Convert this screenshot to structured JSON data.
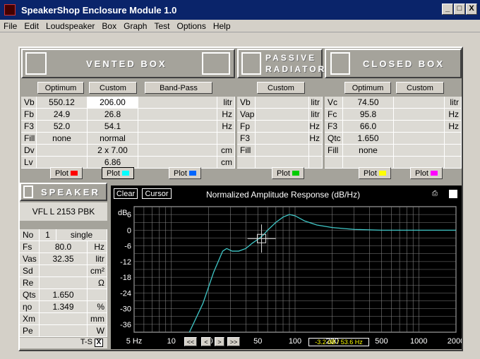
{
  "window": {
    "title": "SpeakerShop Enclosure Module 1.0",
    "min": "_",
    "max": "□",
    "close": "X"
  },
  "menu": [
    "File",
    "Edit",
    "Loudspeaker",
    "Box",
    "Graph",
    "Test",
    "Options",
    "Help"
  ],
  "headers": {
    "vented": "VENTED BOX",
    "passive1": "PASSIVE",
    "passive2": "RADIATOR",
    "closed": "CLOSED BOX",
    "speaker": "SPEAKER"
  },
  "vented": {
    "buttons": [
      "Optimum",
      "Custom",
      "Band-Pass"
    ],
    "rows": [
      {
        "label": "Vb",
        "opt": "550.12",
        "cust": "206.00",
        "bp": "",
        "unit": "litr"
      },
      {
        "label": "Fb",
        "opt": "24.9",
        "cust": "26.8",
        "bp": "",
        "unit": "Hz"
      },
      {
        "label": "F3",
        "opt": "52.0",
        "cust": "54.1",
        "bp": "",
        "unit": "Hz"
      },
      {
        "label": "Fill",
        "opt": "none",
        "cust": "normal",
        "bp": "",
        "unit": ""
      },
      {
        "label": "Dv",
        "opt": "",
        "cust": "2 x 7.00",
        "bp": "",
        "unit": "cm"
      },
      {
        "label": "Lv",
        "opt": "",
        "cust": "6.86",
        "bp": "",
        "unit": "cm"
      }
    ],
    "plot": "Plot"
  },
  "passive": {
    "button": "Custom",
    "rows": [
      {
        "label": "Vb",
        "unit": "litr"
      },
      {
        "label": "Vap",
        "unit": "litr"
      },
      {
        "label": "Fp",
        "unit": "Hz"
      },
      {
        "label": "F3",
        "unit": "Hz"
      },
      {
        "label": "Fill",
        "unit": ""
      },
      {
        "label": "",
        "unit": ""
      }
    ],
    "plot": "Plot"
  },
  "closed": {
    "buttons": [
      "Optimum",
      "Custom"
    ],
    "rows": [
      {
        "label": "Vc",
        "opt": "74.50",
        "unit": "litr"
      },
      {
        "label": "Fc",
        "opt": "95.8",
        "unit": "Hz"
      },
      {
        "label": "F3",
        "opt": "66.0",
        "unit": "Hz"
      },
      {
        "label": "Qtc",
        "opt": "1.650",
        "unit": ""
      },
      {
        "label": "Fill",
        "opt": "none",
        "unit": ""
      },
      {
        "label": "",
        "opt": "",
        "unit": ""
      }
    ],
    "plot": "Plot"
  },
  "swatches": {
    "v_opt": "#ff0000",
    "v_cust": "#00ffff",
    "v_bp": "#0066ff",
    "passive": "#00cc00",
    "c_opt": "#ffff00",
    "c_cust": "#ff00ff"
  },
  "speaker": {
    "name": "VFL L 2153 PBK",
    "rows": [
      {
        "label": "No",
        "val": "1",
        "extra": "single",
        "unit": ""
      },
      {
        "label": "Fs",
        "val": "80.0",
        "extra": "",
        "unit": "Hz"
      },
      {
        "label": "Vas",
        "val": "32.35",
        "extra": "",
        "unit": "litr"
      },
      {
        "label": "Sd",
        "val": "",
        "extra": "",
        "unit": "cm²"
      },
      {
        "label": "Re",
        "val": "",
        "extra": "",
        "unit": "Ω"
      },
      {
        "label": "Qts",
        "val": "1.650",
        "extra": "",
        "unit": ""
      },
      {
        "label": "ηo",
        "val": "1.349",
        "extra": "",
        "unit": "%"
      },
      {
        "label": "Xm",
        "val": "",
        "extra": "",
        "unit": "mm"
      },
      {
        "label": "Pe",
        "val": "",
        "extra": "",
        "unit": "W"
      }
    ],
    "ts": "T-S",
    "ts_check": "X"
  },
  "graph": {
    "clear": "Clear",
    "cursor": "Cursor",
    "title": "Normalized Amplitude Response (dB/Hz)",
    "ylabel": "dB",
    "readout": "-3.2 dB / 53.6 Hz",
    "nav": [
      "<<",
      "<",
      ">",
      ">>"
    ]
  },
  "chart_data": {
    "type": "line",
    "title": "Normalized Amplitude Response (dB/Hz)",
    "xlabel": "Hz",
    "ylabel": "dB",
    "xscale": "log",
    "xlim": [
      5,
      2000
    ],
    "ylim": [
      -39,
      9
    ],
    "xticks": [
      "5 Hz",
      "10",
      "20",
      "50",
      "100",
      "200",
      "500",
      "1000",
      "2000"
    ],
    "yticks": [
      "6",
      "0",
      "-6",
      "-12",
      "-18",
      "-24",
      "-30",
      "-36"
    ],
    "series": [
      {
        "color": "#40c8c8",
        "x": [
          14,
          18,
          22,
          26,
          28,
          31,
          35,
          40,
          45,
          50,
          55,
          60,
          70,
          80,
          90,
          100,
          120,
          150,
          200,
          300,
          500,
          1000,
          2000
        ],
        "y": [
          -39,
          -28,
          -16,
          -8,
          -7,
          -8,
          -8,
          -7,
          -5,
          -3.5,
          -2,
          0,
          3,
          5,
          6,
          5.5,
          3.5,
          2,
          1,
          0.3,
          0,
          0,
          0
        ]
      }
    ],
    "cursor": {
      "x": 53.6,
      "y": -3.2
    }
  }
}
